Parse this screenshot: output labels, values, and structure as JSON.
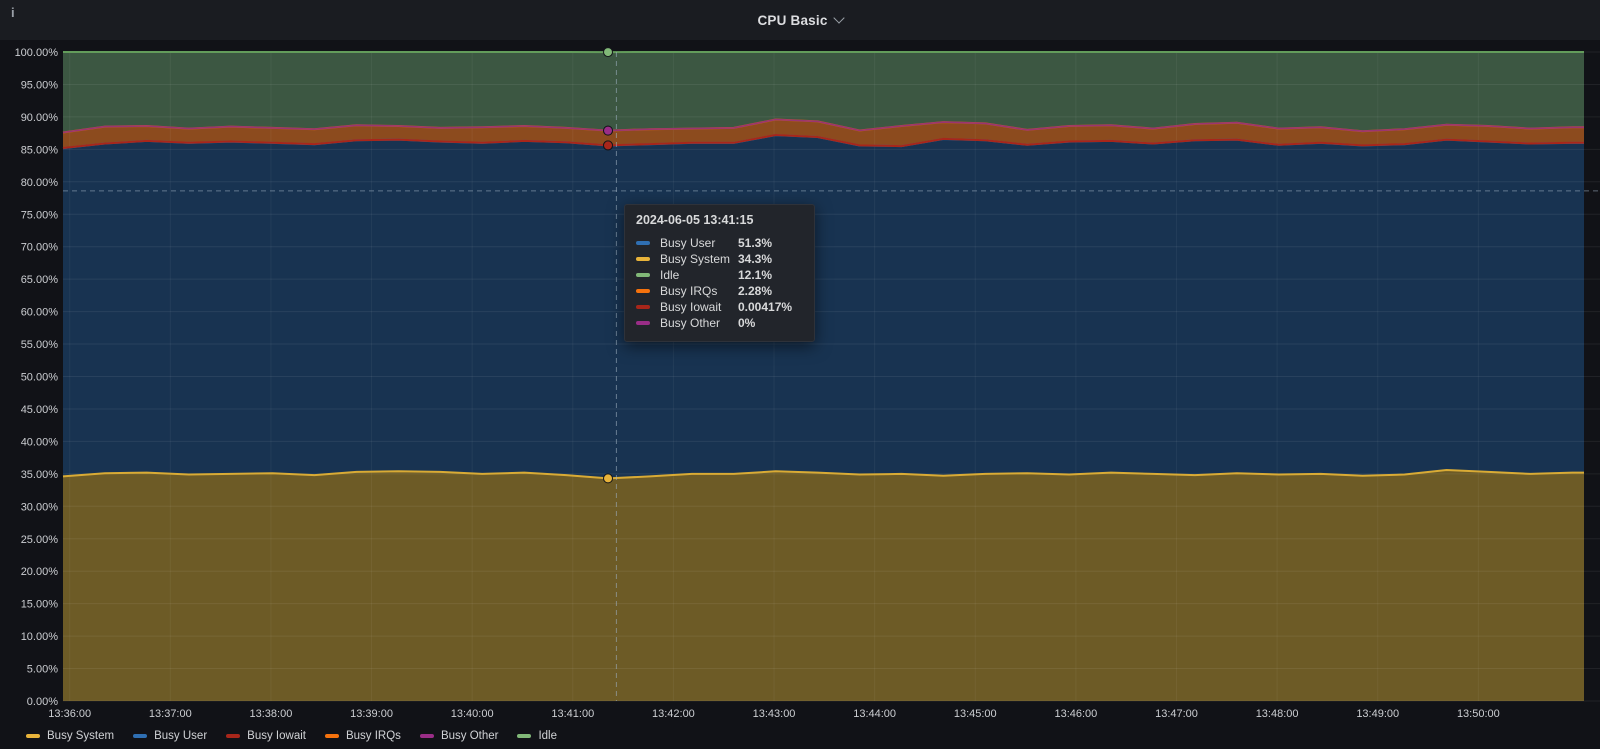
{
  "panel": {
    "title": "CPU Basic",
    "info_icon": "i"
  },
  "tooltip": {
    "timestamp": "2024-06-05 13:41:15",
    "rows": [
      {
        "label": "Busy User",
        "value": "51.3%",
        "color": "#2f6fb3"
      },
      {
        "label": "Busy System",
        "value": "34.3%",
        "color": "#e8b33a"
      },
      {
        "label": "Idle",
        "value": "12.1%",
        "color": "#81b878"
      },
      {
        "label": "Busy IRQs",
        "value": "2.28%",
        "color": "#f5720d"
      },
      {
        "label": "Busy Iowait",
        "value": "0.00417%",
        "color": "#a8261a"
      },
      {
        "label": "Busy Other",
        "value": "0%",
        "color": "#9a2d87"
      }
    ]
  },
  "legend": {
    "items": [
      {
        "label": "Busy System",
        "color": "#e8b33a"
      },
      {
        "label": "Busy User",
        "color": "#2f6fb3"
      },
      {
        "label": "Busy Iowait",
        "color": "#a8261a"
      },
      {
        "label": "Busy IRQs",
        "color": "#f5720d"
      },
      {
        "label": "Busy Other",
        "color": "#9a2d87"
      },
      {
        "label": "Idle",
        "color": "#81b878"
      }
    ]
  },
  "chart_data": {
    "type": "area",
    "stacked": true,
    "unit": "percent",
    "ylim": [
      0,
      100
    ],
    "y_tick_step_pct": 5,
    "y_ticks": [
      "100.00%",
      "95.00%",
      "90.00%",
      "85.00%",
      "80.00%",
      "75.00%",
      "70.00%",
      "65.00%",
      "60.00%",
      "55.00%",
      "50.00%",
      "45.00%",
      "40.00%",
      "35.00%",
      "30.00%",
      "25.00%",
      "20.00%",
      "15.00%",
      "10.00%",
      "5.00%",
      "0.00%"
    ],
    "x_ticks": [
      "13:36:00",
      "13:37:00",
      "13:38:00",
      "13:39:00",
      "13:40:00",
      "13:41:00",
      "13:42:00",
      "13:43:00",
      "13:44:00",
      "13:45:00",
      "13:46:00",
      "13:47:00",
      "13:48:00",
      "13:49:00",
      "13:50:00"
    ],
    "x_start_clock": "13:35:56",
    "x_first_tick_offset_s": 4,
    "x_tick_interval_s": 60,
    "time_offsets_s": [
      0,
      25,
      50,
      75,
      100,
      125,
      150,
      175,
      200,
      225,
      250,
      275,
      300,
      325,
      350,
      375,
      400,
      425,
      450,
      475,
      500,
      525,
      550,
      575,
      600,
      625,
      650,
      675,
      700,
      725,
      750,
      775,
      800,
      825,
      850,
      875,
      900,
      907
    ],
    "series": [
      {
        "name": "Busy System",
        "color": "#e8b33a",
        "line": "#d9ab35",
        "fill": "#6d5b26",
        "values": [
          34.6,
          35.1,
          35.2,
          34.9,
          35.0,
          35.1,
          34.8,
          35.3,
          35.4,
          35.3,
          35.0,
          35.2,
          34.8,
          34.3,
          34.6,
          35.0,
          35.0,
          35.4,
          35.2,
          34.9,
          35.0,
          34.7,
          35.0,
          35.1,
          34.9,
          35.2,
          35.0,
          34.8,
          35.1,
          34.9,
          35.0,
          34.7,
          34.9,
          35.6,
          35.3,
          35.0,
          35.2,
          35.2
        ]
      },
      {
        "name": "Busy User",
        "color": "#2f6fb3",
        "line": "#2f6fb3",
        "fill": "#183351",
        "values": [
          50.6,
          50.8,
          51.1,
          51.1,
          51.2,
          50.9,
          51.0,
          51.1,
          51.1,
          50.9,
          51.0,
          51.1,
          51.3,
          51.3,
          51.2,
          51.0,
          51.0,
          51.8,
          51.7,
          50.7,
          50.5,
          51.9,
          51.4,
          50.6,
          51.3,
          51.1,
          50.9,
          51.6,
          51.4,
          50.8,
          51.0,
          50.9,
          50.9,
          50.9,
          50.9,
          50.9,
          50.8,
          50.8
        ]
      },
      {
        "name": "Busy Iowait",
        "color": "#a8261a",
        "line": "#a8261a",
        "fill": null,
        "values": 0.004
      },
      {
        "name": "Busy IRQs",
        "color": "#f5720d",
        "line": "#cf6120",
        "fill": "#8c4b1e",
        "values": [
          2.4,
          2.6,
          2.3,
          2.2,
          2.3,
          2.3,
          2.3,
          2.3,
          2.1,
          2.1,
          2.4,
          2.3,
          2.2,
          2.28,
          2.3,
          2.2,
          2.3,
          2.4,
          2.4,
          2.3,
          3.1,
          2.6,
          2.6,
          2.3,
          2.4,
          2.4,
          2.3,
          2.5,
          2.6,
          2.5,
          2.4,
          2.2,
          2.3,
          2.3,
          2.4,
          2.3,
          2.4,
          2.4
        ]
      },
      {
        "name": "Busy Other",
        "color": "#9a2d87",
        "line": "#8f2d80",
        "fill": null,
        "values": 0
      },
      {
        "name": "Idle",
        "color": "#81b878",
        "line": "#639c5b",
        "fill": "#3c5742",
        "values": [
          12.4,
          11.5,
          11.4,
          11.8,
          11.5,
          11.7,
          11.9,
          11.3,
          11.4,
          11.7,
          11.6,
          11.4,
          11.7,
          12.1,
          11.9,
          11.8,
          11.7,
          10.4,
          10.7,
          12.1,
          11.4,
          10.8,
          11.0,
          12.0,
          11.4,
          11.3,
          11.8,
          11.1,
          10.9,
          11.8,
          11.6,
          12.2,
          11.9,
          11.2,
          11.4,
          11.8,
          11.6,
          11.6
        ]
      }
    ],
    "crosshair": {
      "cursor_time_offset_s": 330,
      "cursor_value_pct": 78.6,
      "hover_point_index": 13
    }
  },
  "colors": {
    "page_bg": "#111217",
    "header_bg": "#1a1c21",
    "grid": "#ffffff",
    "axis_text": "#ccced2",
    "crosshair": "#9fb1c2",
    "tooltip_bg": "#22252b"
  }
}
